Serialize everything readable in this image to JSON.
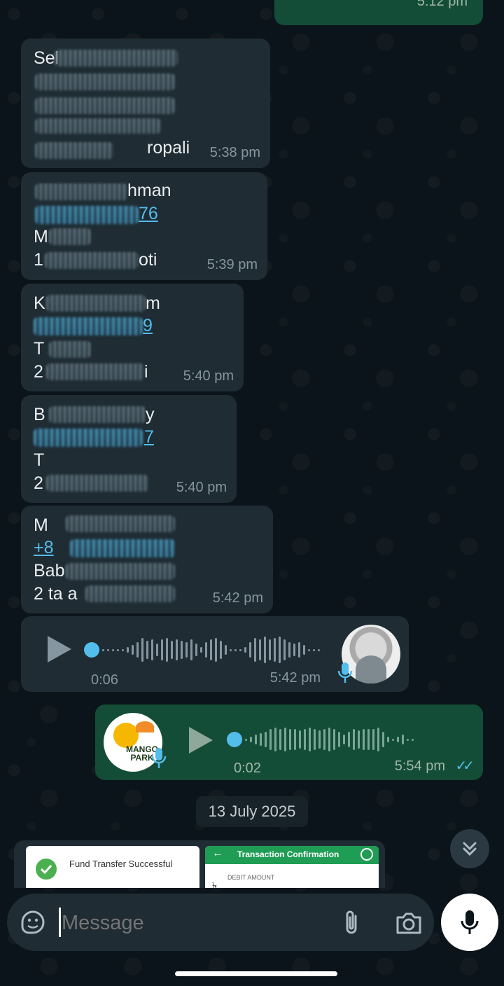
{
  "top_partial_message": {
    "time": "5:12 pm"
  },
  "messages": [
    {
      "lines": [
        "Sel",
        "",
        "",
        "ropali"
      ],
      "time": "5:38 pm"
    },
    {
      "lines": [
        "hman",
        "76",
        "M",
        "1",
        "oti"
      ],
      "time": "5:39 pm"
    },
    {
      "lines": [
        "K",
        "m",
        "9",
        "T",
        "2",
        "i"
      ],
      "time": "5:40 pm"
    },
    {
      "lines": [
        "B",
        "y",
        "7",
        "T",
        "2"
      ],
      "time": "5:40 pm"
    },
    {
      "lines": [
        "M",
        "+8",
        "Bab",
        "2 ta a"
      ],
      "time": "5:42 pm"
    }
  ],
  "voice_in": {
    "duration": "0:06",
    "time": "5:42 pm",
    "progress": 0
  },
  "voice_out": {
    "duration": "0:02",
    "time": "5:54 pm",
    "progress": 0,
    "avatar_text": [
      "MANGO",
      "PARK"
    ],
    "read_ticks": "✓✓"
  },
  "date_separator": "13 July 2025",
  "image_preview": {
    "card1_text": "Fund Transfer Successful",
    "card2_title": "Transaction Confirmation",
    "card2_label": "DEBIT AMOUNT"
  },
  "composer": {
    "placeholder": "Message"
  },
  "colors": {
    "accent": "#53bdeb",
    "outgoing_bubble": "#144d37",
    "incoming_bubble": "#1f2c34",
    "success": "#4caf50",
    "header_green": "#1f9d55"
  }
}
